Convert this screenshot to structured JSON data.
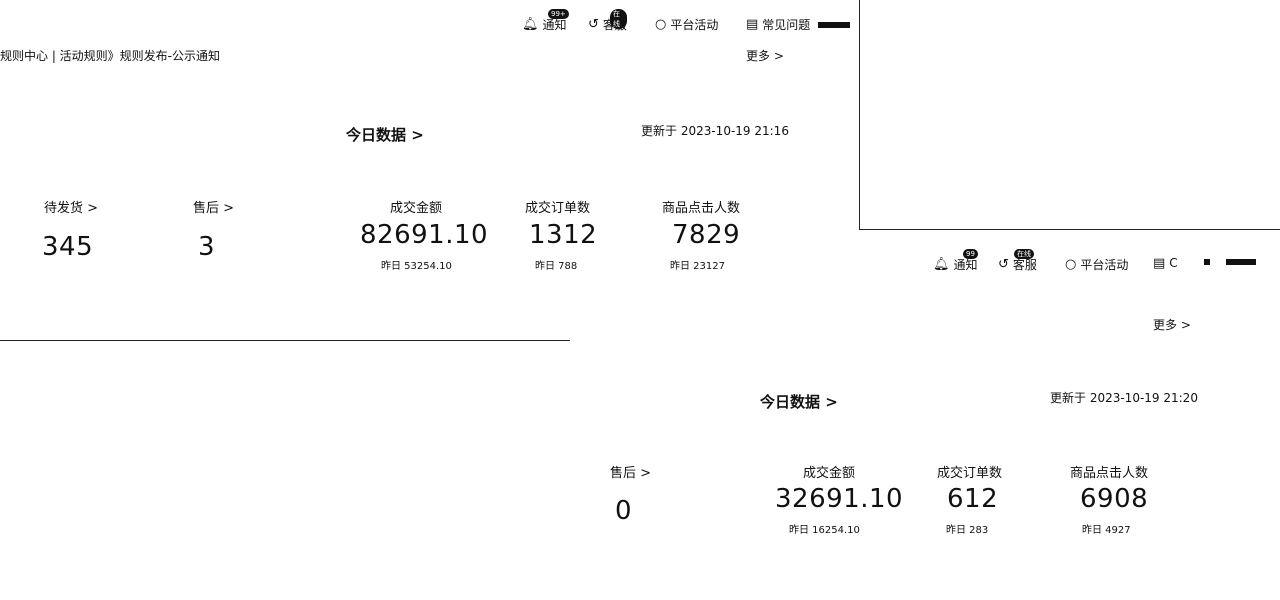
{
  "left": {
    "nav": {
      "notice": "通知",
      "notice_badge": "99+",
      "service": "客服",
      "service_badge": "在线",
      "platform": "平台活动",
      "faq": "常见问题"
    },
    "breadcrumb": "规则中心 | 活动规则》规则发布-公示通知",
    "more": "更多 >",
    "today_title": "今日数据 >",
    "update_time": "更新于 2023-10-19 21:16",
    "pending": {
      "label": "待发货 >",
      "value": "345"
    },
    "after_sales": {
      "label": "售后 >",
      "value": "3"
    },
    "metrics": [
      {
        "label": "成交金额",
        "value": "82691.10",
        "sub": "昨日 53254.10"
      },
      {
        "label": "成交订单数",
        "value": "1312",
        "sub": "昨日 788"
      },
      {
        "label": "商品点击人数",
        "value": "7829",
        "sub": "昨日 23127"
      }
    ]
  },
  "right": {
    "nav": {
      "notice": "通知",
      "notice_badge": "99",
      "service": "客服",
      "service_badge": "在线",
      "platform": "平台活动",
      "c": "C"
    },
    "more": "更多 >",
    "today_title": "今日数据 >",
    "update_time": "更新于 2023-10-19 21:20",
    "after_sales": {
      "label": "售后 >",
      "value": "0"
    },
    "metrics": [
      {
        "label": "成交金额",
        "value": "32691.10",
        "sub": "昨日 16254.10"
      },
      {
        "label": "成交订单数",
        "value": "612",
        "sub": "昨日 283"
      },
      {
        "label": "商品点击人数",
        "value": "6908",
        "sub": "昨日 4927"
      }
    ]
  }
}
